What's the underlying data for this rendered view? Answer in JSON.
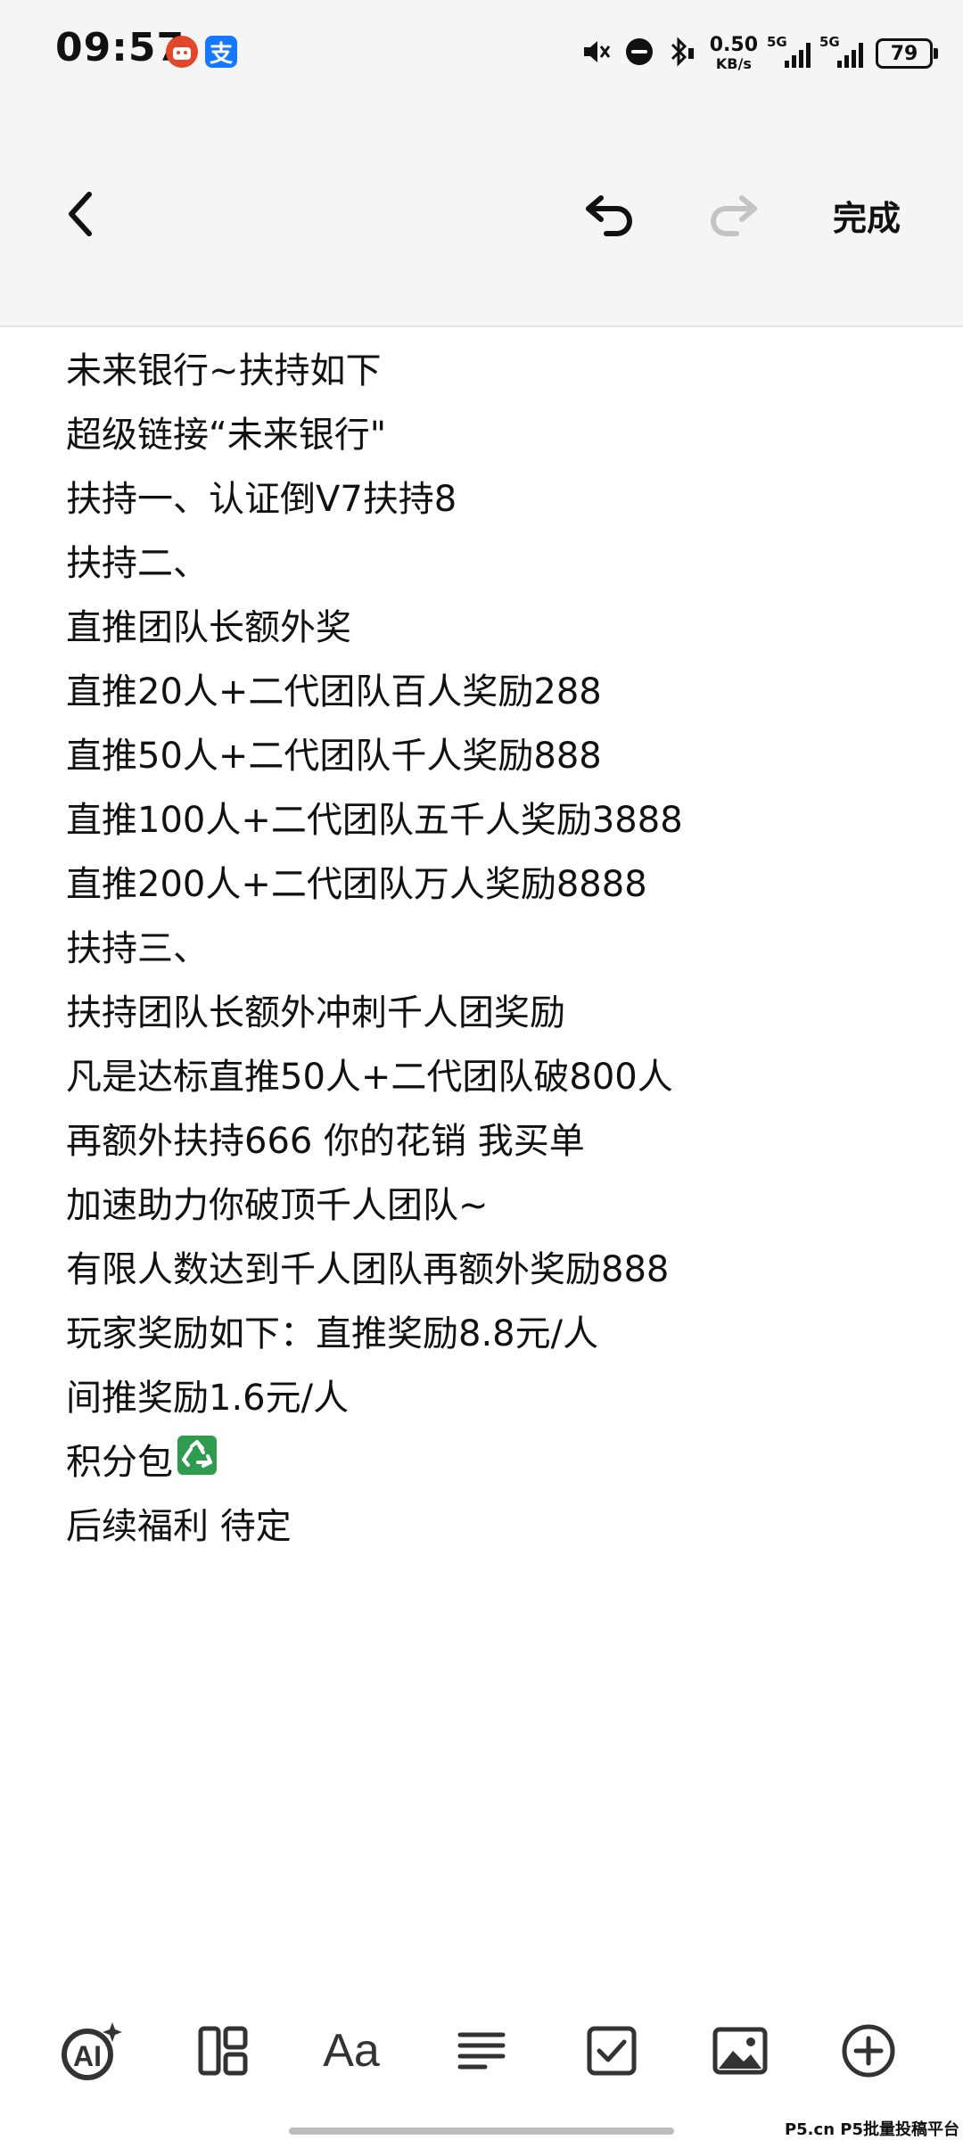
{
  "status_bar": {
    "time": "09:57",
    "notification_icons": [
      "app-red-icon",
      "alipay-icon"
    ],
    "alipay_glyph": "支",
    "net_speed_value": "0.50",
    "net_speed_unit": "KB/s",
    "network_1": "5G",
    "network_2": "5G",
    "battery": "79",
    "icons": [
      "mute-icon",
      "do-not-disturb-icon",
      "bluetooth-icon",
      "signal-icon",
      "battery-icon"
    ]
  },
  "toolbar": {
    "back_icon": "chevron-left-icon",
    "undo_icon": "undo-icon",
    "redo_icon": "redo-icon",
    "done_label": "完成"
  },
  "note": {
    "lines": [
      "未来银行~扶持如下",
      "超级链接“未来银行\"",
      "扶持一、认证倒V7扶持8",
      "扶持二、",
      "直推团队长额外奖",
      "直推20人+二代团队百人奖励288",
      "直推50人+二代团队千人奖励888",
      "直推100人+二代团队五千人奖励3888",
      "直推200人+二代团队万人奖励8888",
      "扶持三、",
      "扶持团队长额外冲刺千人团奖励",
      "凡是达标直推50人+二代团队破800人",
      "再额外扶持666 你的花销 我买单",
      "加速助力你破顶千人团队~",
      "有限人数达到千人团队再额外奖励888",
      "玩家奖励如下：直推奖励8.8元/人",
      "间推奖励1.6元/人",
      "积分包",
      "后续福利 待定"
    ],
    "emoji_after_line_18": "recycle-icon"
  },
  "bottom_bar": {
    "items": [
      {
        "name": "ai-icon",
        "label": "AI"
      },
      {
        "name": "layout-icon"
      },
      {
        "name": "text-format-icon",
        "label": "Aa"
      },
      {
        "name": "align-icon"
      },
      {
        "name": "checkbox-icon"
      },
      {
        "name": "image-icon"
      },
      {
        "name": "add-icon"
      }
    ]
  },
  "watermark": "P5.cn P5批量投稿平台"
}
